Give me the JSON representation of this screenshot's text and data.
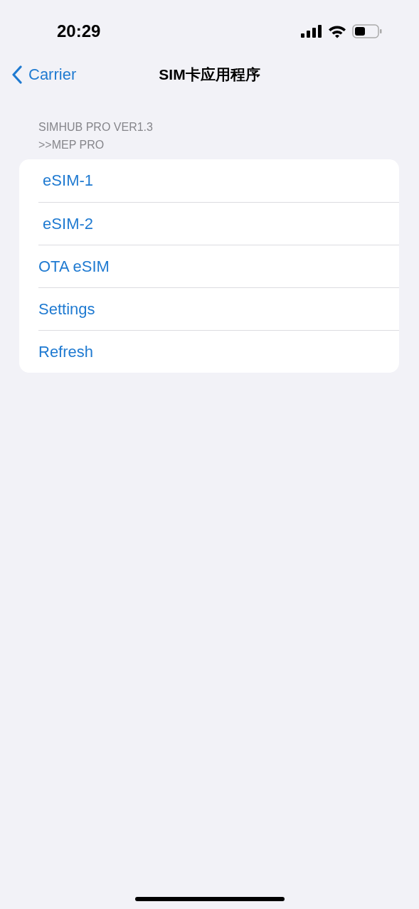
{
  "status_bar": {
    "time": "20:29"
  },
  "nav": {
    "back_label": "Carrier",
    "title": "SIM卡应用程序"
  },
  "section": {
    "header_lines": [
      "SIMHUB PRO VER1.3",
      ">>MEP PRO"
    ],
    "items": [
      {
        "label": " eSIM-1"
      },
      {
        "label": " eSIM-2"
      },
      {
        "label": "OTA eSIM"
      },
      {
        "label": "Settings"
      },
      {
        "label": "Refresh"
      }
    ]
  }
}
